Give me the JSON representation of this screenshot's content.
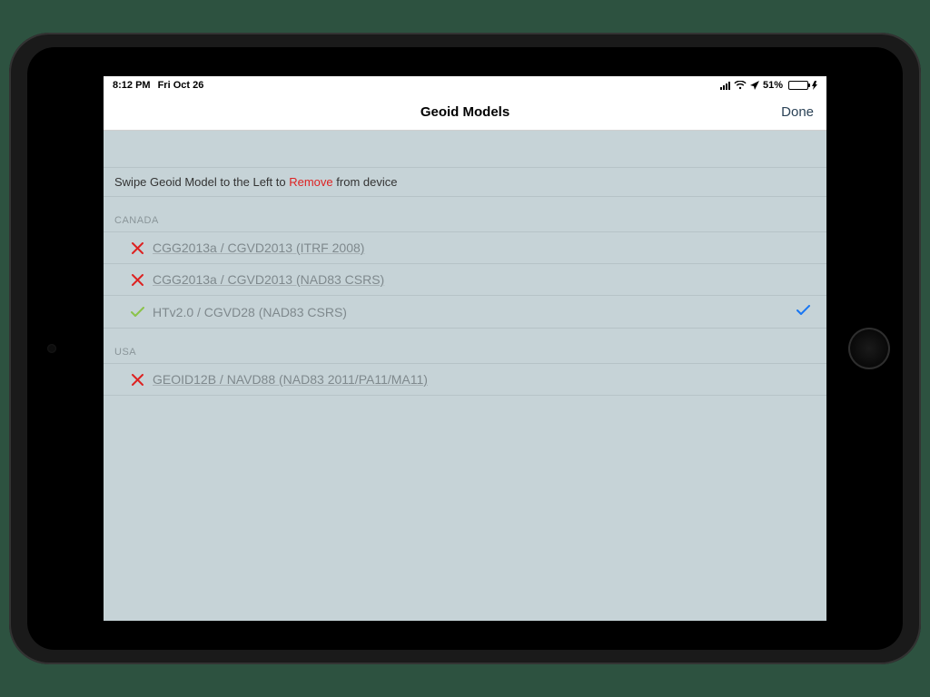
{
  "status": {
    "time": "8:12 PM",
    "date": "Fri Oct 26",
    "battery_pct": "51%"
  },
  "nav": {
    "title": "Geoid Models",
    "done": "Done"
  },
  "instruction": {
    "prefix": "Swipe Geoid Model to the Left to ",
    "remove": "Remove",
    "suffix": " from device"
  },
  "sections": [
    {
      "header": "CANADA",
      "items": [
        {
          "status": "x",
          "label": "CGG2013a / CGVD2013 (ITRF 2008)",
          "dim": true,
          "selected": false
        },
        {
          "status": "x",
          "label": "CGG2013a / CGVD2013 (NAD83 CSRS)",
          "dim": true,
          "selected": false
        },
        {
          "status": "check",
          "label": "HTv2.0 / CGVD28 (NAD83 CSRS)",
          "dim": false,
          "selected": true
        }
      ]
    },
    {
      "header": "USA",
      "items": [
        {
          "status": "x",
          "label": "GEOID12B / NAVD88 (NAD83 2011/PA11/MA11)",
          "dim": true,
          "selected": false
        }
      ]
    }
  ],
  "icons": {
    "x_color": "#d22",
    "check_color": "#8bc34a",
    "selected_color": "#1976f2"
  }
}
